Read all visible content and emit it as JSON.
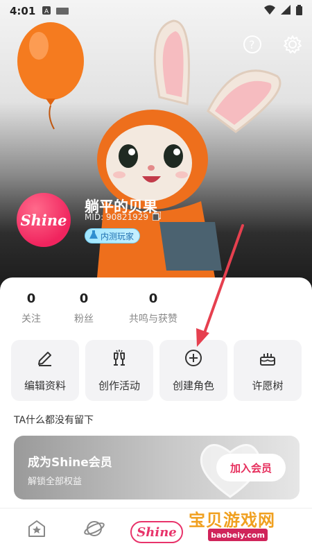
{
  "status_bar": {
    "time": "4:01"
  },
  "profile": {
    "avatar_text": "Shine",
    "nickname": "躺平的贝果",
    "mid": "MID: 90821929",
    "badge": "内测玩家"
  },
  "stats": [
    {
      "value": "0",
      "label": "关注"
    },
    {
      "value": "0",
      "label": "粉丝"
    },
    {
      "value": "0",
      "label": "共鸣与获赞"
    }
  ],
  "actions": [
    {
      "label": "编辑资料",
      "icon": "pencil-icon"
    },
    {
      "label": "创作活动",
      "icon": "cheers-icon"
    },
    {
      "label": "创建角色",
      "icon": "plus-circle-icon"
    },
    {
      "label": "许愿树",
      "icon": "cake-icon"
    }
  ],
  "empty_text": "TA什么都没有留下",
  "vip": {
    "title": "成为Shine会员",
    "subtitle": "解锁全部权益",
    "button": "加入会员"
  },
  "tabbar": {
    "shine_label": "Shine"
  },
  "watermark": {
    "title": "宝贝游戏网",
    "url": "baobeiy.com"
  },
  "colors": {
    "accent": "#e8336a",
    "badge_text": "#1f6fb0"
  }
}
